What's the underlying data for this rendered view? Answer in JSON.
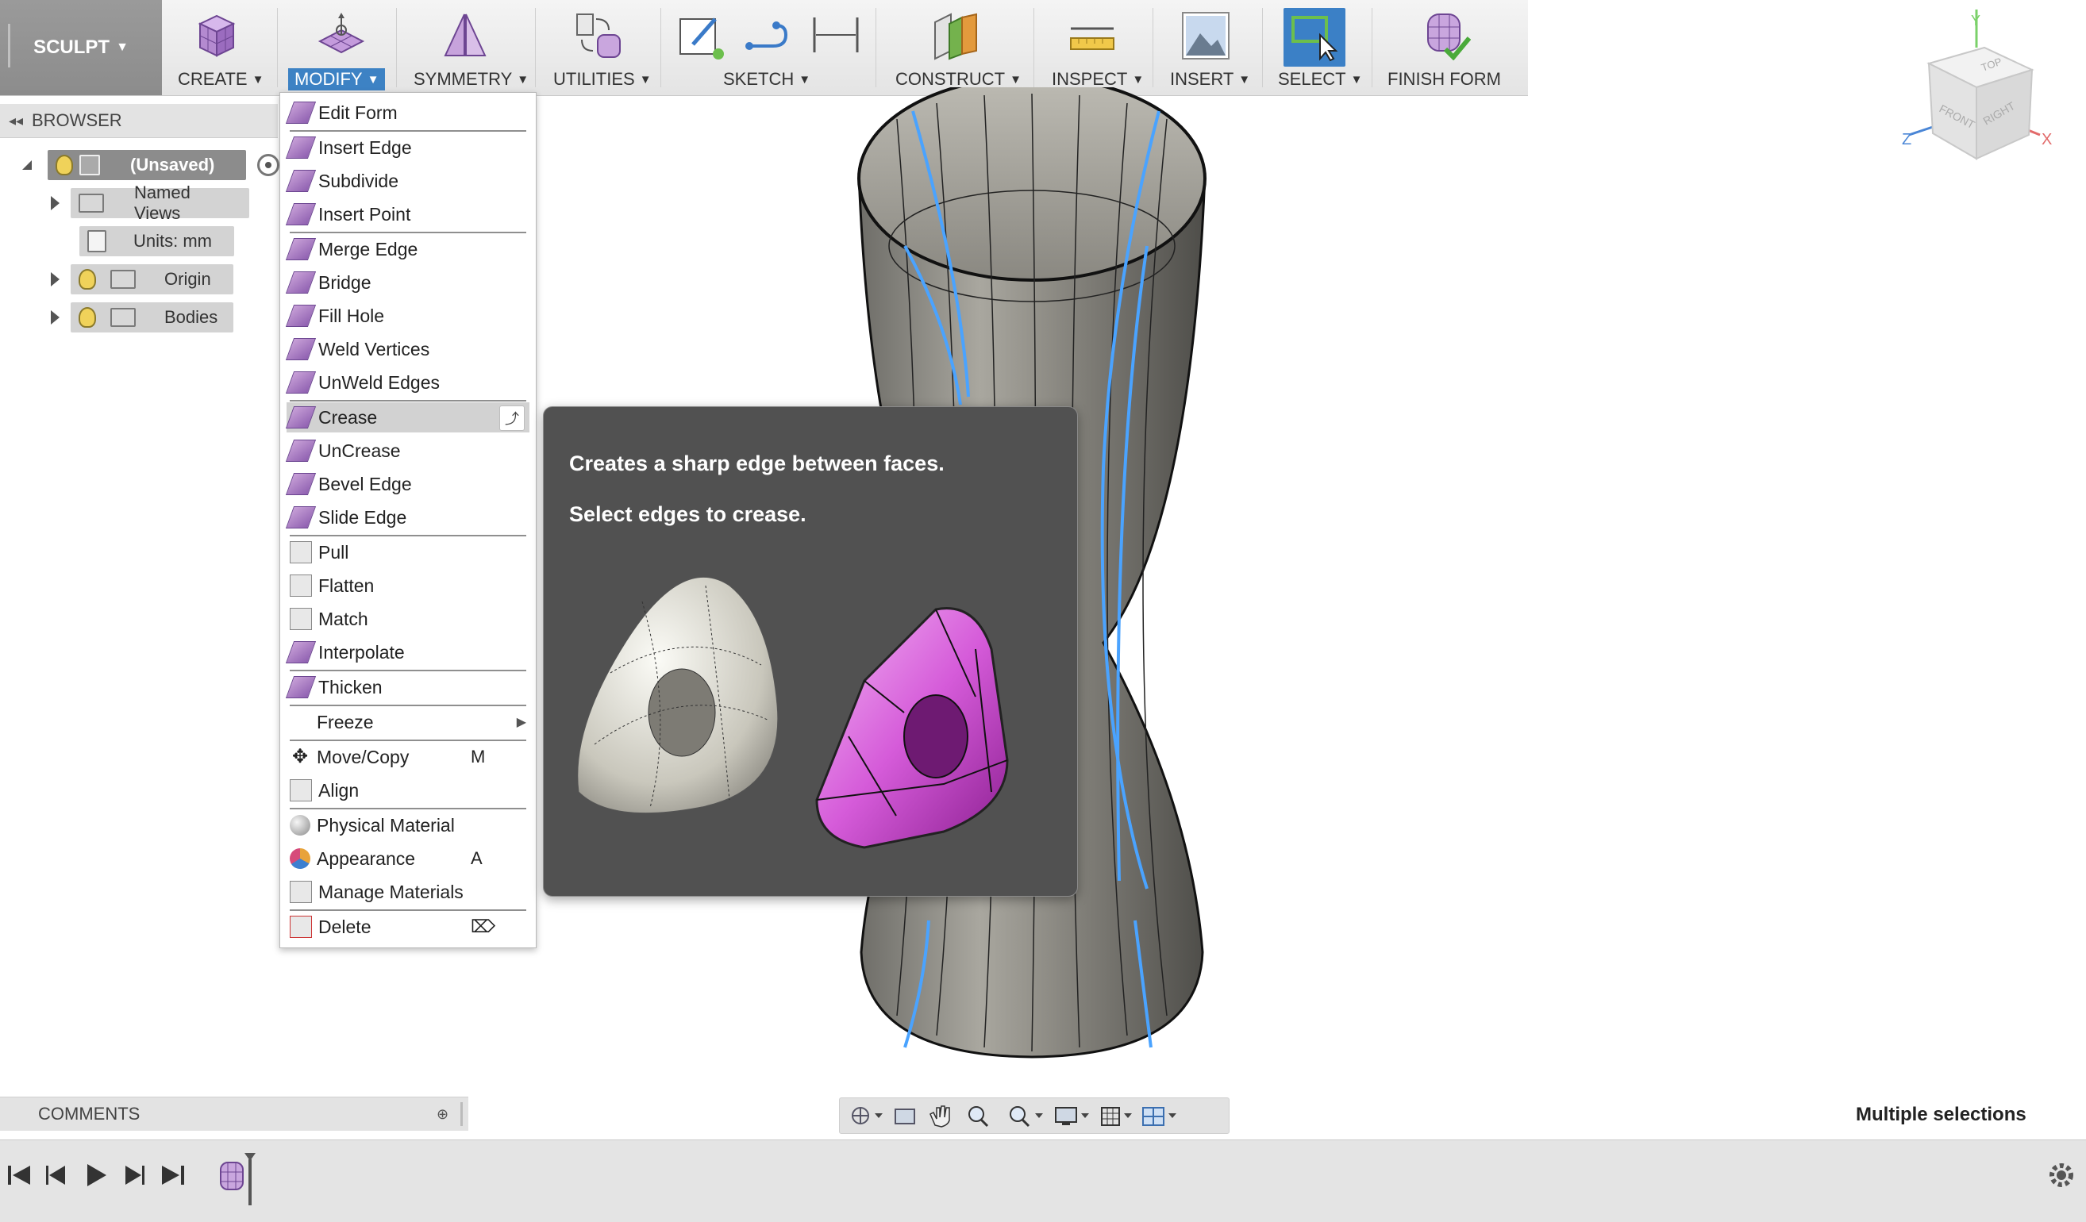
{
  "toolbar": {
    "mode_label": "SCULPT",
    "groups": [
      {
        "label": "CREATE"
      },
      {
        "label": "MODIFY"
      },
      {
        "label": "SYMMETRY"
      },
      {
        "label": "UTILITIES"
      },
      {
        "label": "SKETCH"
      },
      {
        "label": "CONSTRUCT"
      },
      {
        "label": "INSPECT"
      },
      {
        "label": "INSERT"
      },
      {
        "label": "SELECT"
      },
      {
        "label": "FINISH FORM"
      }
    ]
  },
  "viewcube": {
    "top": "TOP",
    "front": "FRONT",
    "right": "RIGHT",
    "axis_x": "X",
    "axis_y": "Y",
    "axis_z": "Z"
  },
  "browser": {
    "title": "BROWSER",
    "root": "(Unsaved)",
    "items": [
      {
        "label": "Named Views"
      },
      {
        "label": "Units: mm"
      },
      {
        "label": "Origin"
      },
      {
        "label": "Bodies"
      }
    ]
  },
  "menu": {
    "items": [
      {
        "label": "Edit Form"
      },
      {
        "label": "Insert Edge"
      },
      {
        "label": "Subdivide"
      },
      {
        "label": "Insert Point"
      },
      {
        "label": "Merge Edge"
      },
      {
        "label": "Bridge"
      },
      {
        "label": "Fill Hole"
      },
      {
        "label": "Weld Vertices"
      },
      {
        "label": "UnWeld Edges"
      },
      {
        "label": "Crease"
      },
      {
        "label": "UnCrease"
      },
      {
        "label": "Bevel Edge"
      },
      {
        "label": "Slide Edge"
      },
      {
        "label": "Pull"
      },
      {
        "label": "Flatten"
      },
      {
        "label": "Match"
      },
      {
        "label": "Interpolate"
      },
      {
        "label": "Thicken"
      },
      {
        "label": "Freeze"
      },
      {
        "label": "Move/Copy",
        "shortcut": "M"
      },
      {
        "label": "Align"
      },
      {
        "label": "Physical Material"
      },
      {
        "label": "Appearance",
        "shortcut": "A"
      },
      {
        "label": "Manage Materials"
      },
      {
        "label": "Delete"
      }
    ],
    "highlighted": "Crease"
  },
  "tooltip": {
    "line1": "Creates a sharp edge between faces.",
    "line2": "Select edges to crease."
  },
  "comments": {
    "title": "COMMENTS"
  },
  "status": {
    "selection": "Multiple selections"
  },
  "colors": {
    "accent": "#3d82c4",
    "selection_edges": "#4aa3ff",
    "tooltip_bg": "#515151"
  }
}
